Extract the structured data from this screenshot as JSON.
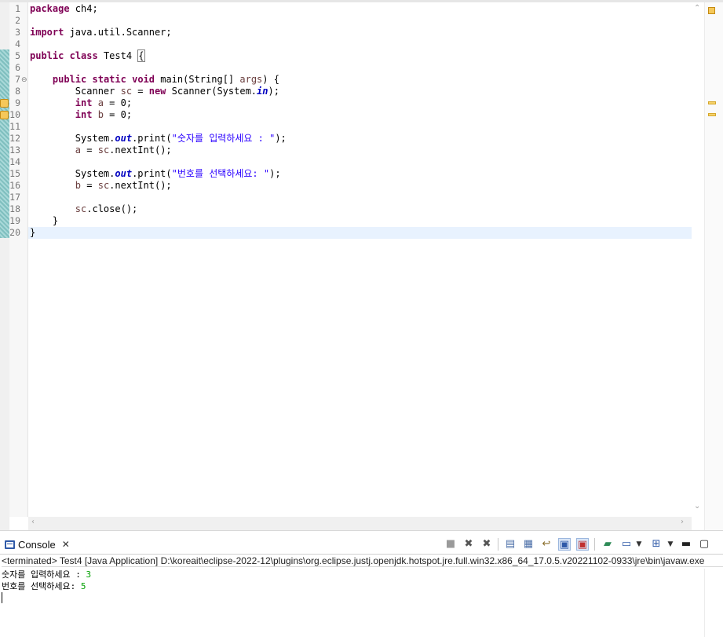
{
  "editor": {
    "lines": [
      {
        "n": "1",
        "parts": [
          {
            "t": "package",
            "c": "kw"
          },
          {
            "t": " ch4;",
            "c": ""
          }
        ]
      },
      {
        "n": "2",
        "parts": []
      },
      {
        "n": "3",
        "parts": [
          {
            "t": "import",
            "c": "kw"
          },
          {
            "t": " java.util.Scanner;",
            "c": ""
          }
        ]
      },
      {
        "n": "4",
        "parts": []
      },
      {
        "n": "5",
        "parts": [
          {
            "t": "public",
            "c": "kw"
          },
          {
            "t": " ",
            "c": ""
          },
          {
            "t": "class",
            "c": "kw"
          },
          {
            "t": " Test4 ",
            "c": ""
          },
          {
            "t": "{",
            "c": "brace-box"
          }
        ]
      },
      {
        "n": "6",
        "parts": []
      },
      {
        "n": "7",
        "parts": [
          {
            "t": "    ",
            "c": ""
          },
          {
            "t": "public",
            "c": "kw"
          },
          {
            "t": " ",
            "c": ""
          },
          {
            "t": "static",
            "c": "kw"
          },
          {
            "t": " ",
            "c": ""
          },
          {
            "t": "void",
            "c": "kw"
          },
          {
            "t": " main(String[] ",
            "c": ""
          },
          {
            "t": "args",
            "c": "var"
          },
          {
            "t": ") {",
            "c": ""
          }
        ]
      },
      {
        "n": "8",
        "parts": [
          {
            "t": "        Scanner ",
            "c": ""
          },
          {
            "t": "sc",
            "c": "var"
          },
          {
            "t": " = ",
            "c": ""
          },
          {
            "t": "new",
            "c": "kw"
          },
          {
            "t": " Scanner(System.",
            "c": ""
          },
          {
            "t": "in",
            "c": "fld"
          },
          {
            "t": ");",
            "c": ""
          }
        ]
      },
      {
        "n": "9",
        "parts": [
          {
            "t": "        ",
            "c": ""
          },
          {
            "t": "int",
            "c": "kw"
          },
          {
            "t": " ",
            "c": ""
          },
          {
            "t": "a",
            "c": "var"
          },
          {
            "t": " = 0;",
            "c": ""
          }
        ]
      },
      {
        "n": "10",
        "parts": [
          {
            "t": "        ",
            "c": ""
          },
          {
            "t": "int",
            "c": "kw"
          },
          {
            "t": " ",
            "c": ""
          },
          {
            "t": "b",
            "c": "var"
          },
          {
            "t": " = 0;",
            "c": ""
          }
        ]
      },
      {
        "n": "11",
        "parts": []
      },
      {
        "n": "12",
        "parts": [
          {
            "t": "        System.",
            "c": ""
          },
          {
            "t": "out",
            "c": "fld"
          },
          {
            "t": ".print(",
            "c": ""
          },
          {
            "t": "\"숫자를 입력하세요 : \"",
            "c": "str"
          },
          {
            "t": ");",
            "c": ""
          }
        ]
      },
      {
        "n": "13",
        "parts": [
          {
            "t": "        ",
            "c": ""
          },
          {
            "t": "a",
            "c": "var"
          },
          {
            "t": " = ",
            "c": ""
          },
          {
            "t": "sc",
            "c": "var"
          },
          {
            "t": ".nextInt();",
            "c": ""
          }
        ]
      },
      {
        "n": "14",
        "parts": []
      },
      {
        "n": "15",
        "parts": [
          {
            "t": "        System.",
            "c": ""
          },
          {
            "t": "out",
            "c": "fld"
          },
          {
            "t": ".print(",
            "c": ""
          },
          {
            "t": "\"번호를 선택하세요: \"",
            "c": "str"
          },
          {
            "t": ");",
            "c": ""
          }
        ]
      },
      {
        "n": "16",
        "parts": [
          {
            "t": "        ",
            "c": ""
          },
          {
            "t": "b",
            "c": "var"
          },
          {
            "t": " = ",
            "c": ""
          },
          {
            "t": "sc",
            "c": "var"
          },
          {
            "t": ".nextInt();",
            "c": ""
          }
        ]
      },
      {
        "n": "17",
        "parts": []
      },
      {
        "n": "18",
        "parts": [
          {
            "t": "        ",
            "c": ""
          },
          {
            "t": "sc",
            "c": "var"
          },
          {
            "t": ".close();",
            "c": ""
          }
        ]
      },
      {
        "n": "19",
        "parts": [
          {
            "t": "    }",
            "c": ""
          }
        ]
      },
      {
        "n": "20",
        "parts": [
          {
            "t": "}",
            "c": ""
          }
        ]
      }
    ],
    "current_line": "20",
    "warning_lines": [
      "9",
      "10"
    ]
  },
  "console": {
    "tab_label": "Console",
    "path": "<terminated> Test4 [Java Application] D:\\koreait\\eclipse-2022-12\\plugins\\org.eclipse.justj.openjdk.hotspot.jre.full.win32.x86_64_17.0.5.v20221102-0933\\jre\\bin\\javaw.exe",
    "output": [
      {
        "prompt": "숫자를 입력하세요 : ",
        "input": "3"
      },
      {
        "prompt": "번호를 선택하세요: ",
        "input": "5"
      }
    ]
  },
  "icons": {
    "terminate": "terminate-icon",
    "remove_launch": "remove-launch-icon",
    "remove_all": "remove-all-terminated-icon",
    "clear": "clear-console-icon",
    "scroll_lock": "scroll-lock-icon",
    "word_wrap": "word-wrap-icon",
    "show_on_stdout": "show-on-stdout-icon",
    "show_on_stderr": "show-on-stderr-icon",
    "pin": "pin-console-icon",
    "display_selected": "display-selected-console-icon",
    "open_console": "open-console-icon",
    "minimize": "minimize-icon",
    "maximize": "maximize-icon"
  },
  "colors": {
    "keyword": "#7f0055",
    "string": "#2a00ff",
    "field": "#0000c0",
    "local_var": "#6a3e3e",
    "current_line": "#e8f2fe",
    "console_input": "#00a000"
  }
}
